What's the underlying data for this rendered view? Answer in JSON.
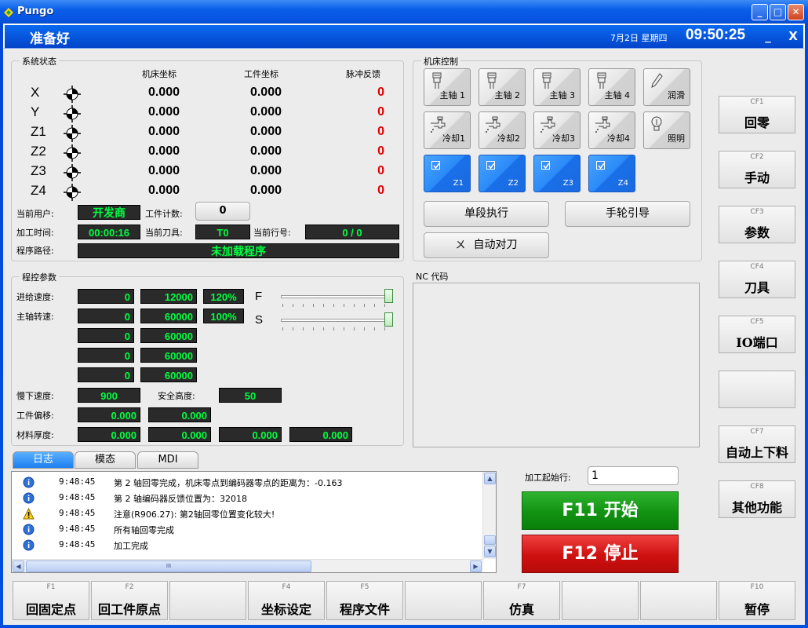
{
  "window": {
    "title": "Pungo"
  },
  "header": {
    "status": "准备好",
    "date": "7月2日 星期四",
    "time": "09:50:25",
    "min": "_",
    "close": "X"
  },
  "system_status": {
    "label": "系统状态",
    "col_machine": "机床坐标",
    "col_work": "工件坐标",
    "col_pulse": "脉冲反馈",
    "axes": [
      {
        "name": "X",
        "machine": "0.000",
        "work": "0.000",
        "pulse": "0"
      },
      {
        "name": "Y",
        "machine": "0.000",
        "work": "0.000",
        "pulse": "0"
      },
      {
        "name": "Z1",
        "machine": "0.000",
        "work": "0.000",
        "pulse": "0"
      },
      {
        "name": "Z2",
        "machine": "0.000",
        "work": "0.000",
        "pulse": "0"
      },
      {
        "name": "Z3",
        "machine": "0.000",
        "work": "0.000",
        "pulse": "0"
      },
      {
        "name": "Z4",
        "machine": "0.000",
        "work": "0.000",
        "pulse": "0"
      }
    ],
    "user_label": "当前用户:",
    "user": "开发商",
    "count_label": "工件计数:",
    "count": "0",
    "time_label": "加工时间:",
    "time": "00:00:16",
    "tool_label": "当前刀具:",
    "tool": "T0",
    "line_label": "当前行号:",
    "line": "0 / 0",
    "path_label": "程序路径:",
    "path": "未加载程序"
  },
  "machine_control": {
    "label": "机床控制",
    "buttons": [
      "主轴 1",
      "主轴 2",
      "主轴 3",
      "主轴 4",
      "润滑",
      "冷却1",
      "冷却2",
      "冷却3",
      "冷却4",
      "照明"
    ],
    "z_buttons": [
      "Z1",
      "Z2",
      "Z3",
      "Z4"
    ],
    "single_step": "单段执行",
    "handwheel": "手轮引导",
    "auto_tool": "自动对刀"
  },
  "program_params": {
    "label": "程控参数",
    "feed_label": "进给速度:",
    "spindle_label": "主轴转速:",
    "rows": [
      {
        "a": "0",
        "b": "12000",
        "pct": "120%"
      },
      {
        "a": "0",
        "b": "60000",
        "pct": "100%"
      },
      {
        "a": "0",
        "b": "60000"
      },
      {
        "a": "0",
        "b": "60000"
      },
      {
        "a": "0",
        "b": "60000"
      }
    ],
    "f_label": "F",
    "s_label": "S",
    "f_level": 1.0,
    "s_level": 1.0,
    "slow_label": "慢下速度:",
    "slow": "900",
    "safe_label": "安全高度:",
    "safe": "50",
    "offset_label": "工件偏移:",
    "offset": [
      "0.000",
      "0.000"
    ],
    "thick_label": "材料厚度:",
    "thick": [
      "0.000",
      "0.000",
      "0.000",
      "0.000"
    ]
  },
  "nc": {
    "label": "NC 代码"
  },
  "tabs": [
    "日志",
    "模态",
    "MDI"
  ],
  "log": [
    {
      "icon": "info",
      "time": "9:48:45",
      "msg": "第 2 轴回零完成，机床零点到编码器零点的距离为：-0.163"
    },
    {
      "icon": "info",
      "time": "9:48:45",
      "msg": "第 2 轴编码器反馈位置为：32018"
    },
    {
      "icon": "warning",
      "time": "9:48:45",
      "msg": "注意(R906.27): 第2轴回零位置变化较大!"
    },
    {
      "icon": "info",
      "time": "9:48:45",
      "msg": "所有轴回零完成"
    },
    {
      "icon": "info",
      "time": "9:48:45",
      "msg": "加工完成"
    }
  ],
  "start_line_label": "加工起始行:",
  "start_line": "1",
  "start": "F11  开始",
  "stop": "F12  停止",
  "right_buttons": [
    {
      "key": "CF1",
      "label": "回零"
    },
    {
      "key": "CF2",
      "label": "手动"
    },
    {
      "key": "CF3",
      "label": "参数"
    },
    {
      "key": "CF4",
      "label": "刀具"
    },
    {
      "key": "CF5",
      "label": "IO端口"
    },
    {
      "key": "",
      "label": ""
    },
    {
      "key": "CF7",
      "label": "自动上下料"
    },
    {
      "key": "CF8",
      "label": "其他功能"
    }
  ],
  "bottom_buttons": [
    {
      "key": "F1",
      "label": "回固定点"
    },
    {
      "key": "F2",
      "label": "回工件原点"
    },
    {
      "key": "",
      "label": ""
    },
    {
      "key": "F4",
      "label": "坐标设定"
    },
    {
      "key": "F5",
      "label": "程序文件"
    },
    {
      "key": "",
      "label": ""
    },
    {
      "key": "F7",
      "label": "仿真"
    },
    {
      "key": "",
      "label": ""
    },
    {
      "key": "",
      "label": ""
    },
    {
      "key": "F10",
      "label": "暂停"
    }
  ],
  "scroll": {
    "thumb": "III"
  }
}
